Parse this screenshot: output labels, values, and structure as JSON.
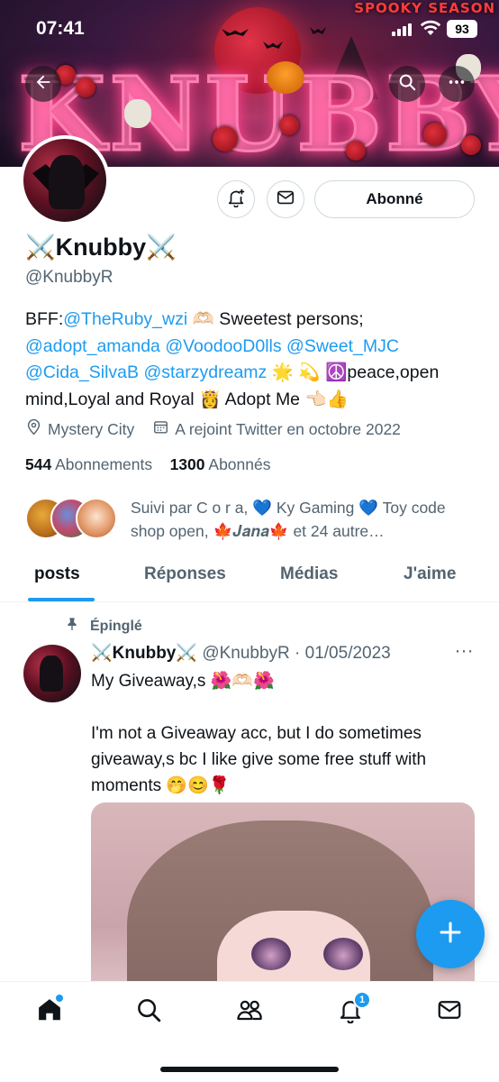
{
  "status_bar": {
    "time": "07:41",
    "battery": "93"
  },
  "banner": {
    "art_text": "KNUBBY",
    "season_text": "SPOOKY SEASON"
  },
  "actions": {
    "follow_label": "Abonné"
  },
  "profile": {
    "display_name": "⚔️Knubby⚔️",
    "handle": "@KnubbyR",
    "bio": {
      "p1": "BFF:",
      "m1": "@TheRuby_wzi",
      "p2": "🫶🏻 Sweetest persons;",
      "m2": "@adopt_amanda",
      "m3": "@VoodooD0lls",
      "m4": "@Sweet_MJC",
      "m5": "@Cida_SilvaB",
      "m6": "@starzydreamz",
      "p3": "🌟 💫 ☮️peace,open mind,Loyal and Royal 👸 Adopt Me 👈🏻👍"
    },
    "location": "Mystery City",
    "joined": "A rejoint Twitter en octobre 2022",
    "following_count": "544",
    "following_label": "Abonnements",
    "followers_count": "1300",
    "followers_label": "Abonnés",
    "followed_by": "Suivi par C o r a, 💙 Ky Gaming 💙 Toy code shop open, 🍁𝑱𝒂𝒏𝒂🍁 et 24 autre…"
  },
  "tabs": [
    "posts",
    "Réponses",
    "Médias",
    "J'aime"
  ],
  "tweet": {
    "pinned_label": "Épinglé",
    "name": "⚔️Knubby⚔️",
    "handle_date": "@KnubbyR · 01/05/2023",
    "more": "···",
    "text": "My Giveaway,s 🌺🫶🏻🌺\n\nI'm not a Giveaway acc, but I do sometimes giveaway,s bc I like give some free stuff with moments 🤭😊🌹"
  },
  "bottom_nav": {
    "notifications_badge": "1"
  },
  "icons": {
    "back": "back-arrow-icon",
    "search": "search-icon",
    "more": "more-icon",
    "notify": "bell-plus-icon",
    "message": "envelope-icon",
    "location": "location-pin-icon",
    "calendar": "calendar-icon",
    "pin": "pin-icon",
    "compose": "plus-icon",
    "home": "home-icon",
    "explore": "search-icon",
    "communities": "people-icon",
    "notifications": "bell-icon",
    "messages": "envelope-icon"
  },
  "colors": {
    "accent": "#1d9bf0",
    "text": "#0f1419",
    "secondary": "#536471",
    "border": "#cfd9de"
  }
}
